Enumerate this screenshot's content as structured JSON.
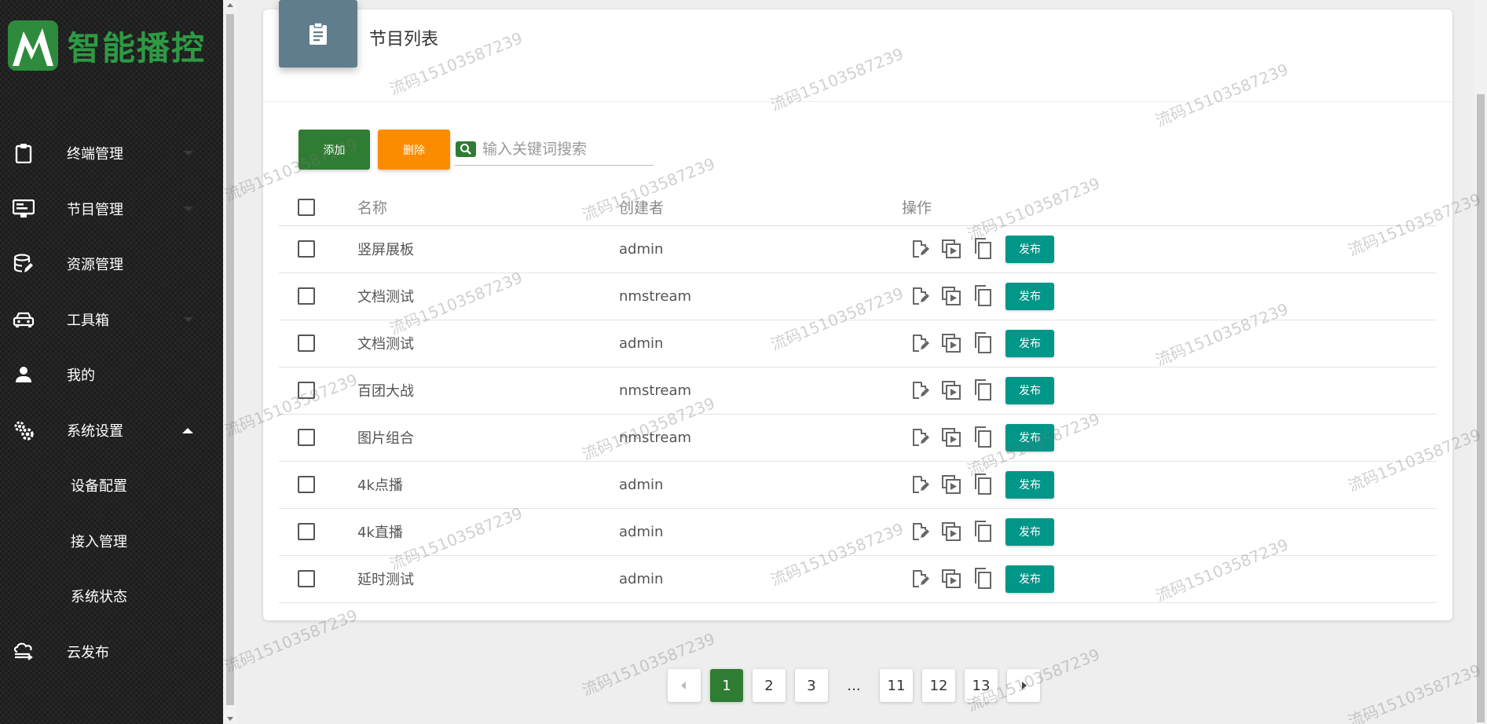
{
  "app": {
    "logo_text": "智能播控"
  },
  "sidebar": {
    "items": [
      {
        "label": "终端管理",
        "icon": "clipboard-icon",
        "caret": "down"
      },
      {
        "label": "节目管理",
        "icon": "monitor-icon",
        "caret": "down"
      },
      {
        "label": "资源管理",
        "icon": "database-edit-icon",
        "caret": ""
      },
      {
        "label": "工具箱",
        "icon": "car-icon",
        "caret": "down"
      },
      {
        "label": "我的",
        "icon": "person-icon",
        "caret": ""
      },
      {
        "label": "系统设置",
        "icon": "gears-icon",
        "caret": "up"
      }
    ],
    "sub_items": [
      "设备配置",
      "接入管理",
      "系统状态"
    ],
    "footer_item": {
      "label": "云发布",
      "icon": "cloud-upload-icon"
    }
  },
  "page": {
    "title": "节目列表",
    "add_label": "添加",
    "delete_label": "删除",
    "search_placeholder": "输入关键词搜索"
  },
  "table": {
    "headers": {
      "name": "名称",
      "creator": "创建者",
      "ops": "操作"
    },
    "publish_label": "发布",
    "rows": [
      {
        "name": "竖屏展板",
        "creator": "admin"
      },
      {
        "name": "文档测试",
        "creator": "nmstream"
      },
      {
        "name": "文档测试",
        "creator": "admin"
      },
      {
        "name": "百团大战",
        "creator": "nmstream"
      },
      {
        "name": "图片组合",
        "creator": "nmstream"
      },
      {
        "name": "4k点播",
        "creator": "admin"
      },
      {
        "name": "4k直播",
        "creator": "admin"
      },
      {
        "name": "延时测试",
        "creator": "admin"
      }
    ]
  },
  "pagination": {
    "current": "1",
    "pages": [
      "1",
      "2",
      "3",
      "...",
      "11",
      "12",
      "13"
    ]
  },
  "watermark": "流码15103587239",
  "colors": {
    "green": "#2e7d32",
    "orange": "#fb8c00",
    "teal": "#009688",
    "header_icon": "#607d8b"
  }
}
